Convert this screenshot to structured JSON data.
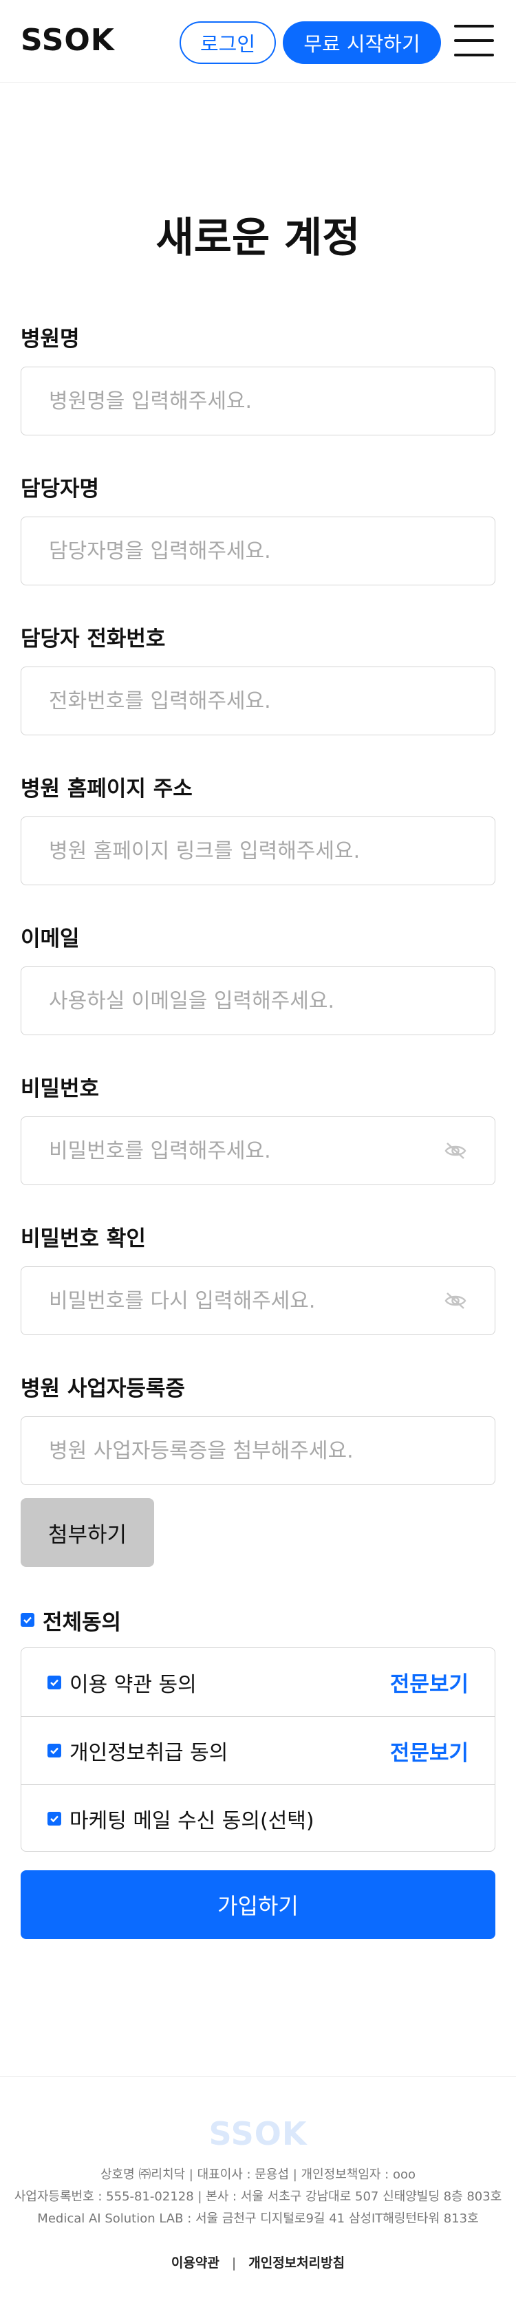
{
  "header": {
    "logo": "SSOK",
    "login_label": "로그인",
    "start_label": "무료 시작하기"
  },
  "page_title": "새로운 계정",
  "fields": [
    {
      "label": "병원명",
      "placeholder": "병원명을 입력해주세요."
    },
    {
      "label": "담당자명",
      "placeholder": "담당자명을 입력해주세요."
    },
    {
      "label": "담당자 전화번호",
      "placeholder": "전화번호를 입력해주세요."
    },
    {
      "label": "병원 홈페이지 주소",
      "placeholder": "병원 홈페이지 링크를 입력해주세요."
    },
    {
      "label": "이메일",
      "placeholder": "사용하실 이메일을 입력해주세요."
    },
    {
      "label": "비밀번호",
      "placeholder": "비밀번호를 입력해주세요."
    },
    {
      "label": "비밀번호 확인",
      "placeholder": "비밀번호를 다시 입력해주세요."
    },
    {
      "label": "병원 사업자등록증",
      "placeholder": "병원 사업자등록증을 첨부해주세요."
    }
  ],
  "attach_label": "첨부하기",
  "agreements": {
    "all_label": "전체동의",
    "items": [
      {
        "label": "이용 약관 동의",
        "view_label": "전문보기"
      },
      {
        "label": "개인정보취급 동의",
        "view_label": "전문보기"
      },
      {
        "label": "마케팅 메일 수신 동의(선택)"
      }
    ]
  },
  "submit_label": "가입하기",
  "footer": {
    "logo": "SSOK",
    "line1": "상호명 ㈜리치닥   |   대표이사 : 문용섭   |   개인정보책임자 : ooo",
    "line2": "사업자등록번호 : 555-81-02128   |   본사 : 서울 서초구 강남대로 507 신태양빌딩 8층 803호",
    "line3": "Medical AI Solution LAB : 서울 금천구 디지털로9길 41 삼성IT해링턴타워 813호",
    "link_terms": "이용약관",
    "link_privacy": "개인정보처리방침"
  },
  "colors": {
    "accent": "#0b6bff",
    "border": "#d4d4d4",
    "attach_bg": "#c8c8c8"
  }
}
